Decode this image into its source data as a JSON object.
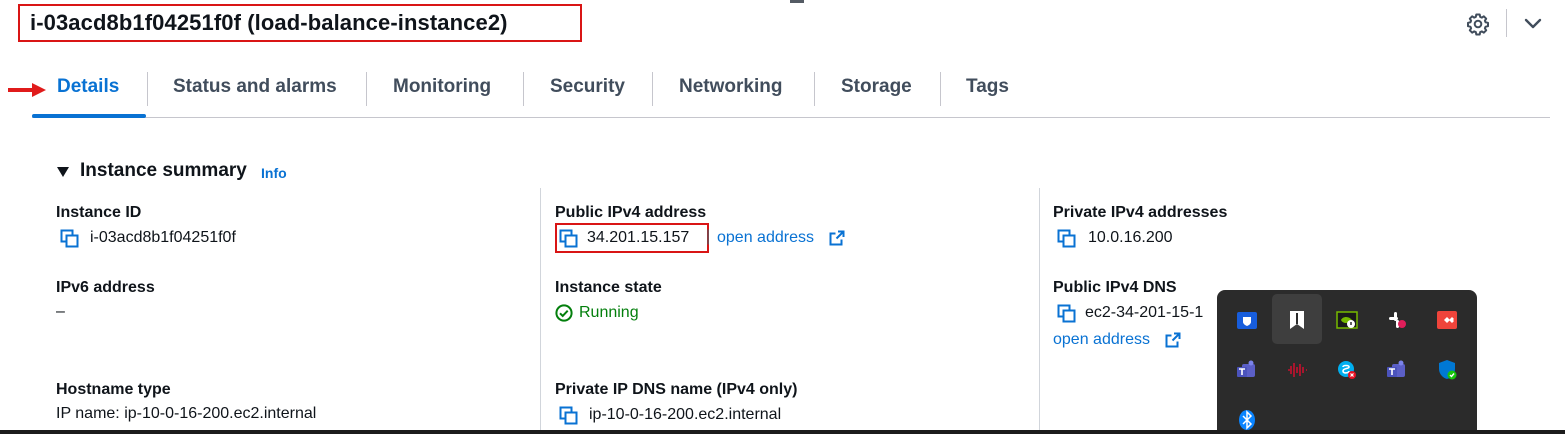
{
  "header": {
    "title": "i-03acd8b1f04251f0f (load-balance-instance2)"
  },
  "tabs": [
    {
      "label": "Details",
      "active": true
    },
    {
      "label": "Status and alarms"
    },
    {
      "label": "Monitoring"
    },
    {
      "label": "Security"
    },
    {
      "label": "Networking"
    },
    {
      "label": "Storage"
    },
    {
      "label": "Tags"
    }
  ],
  "summary": {
    "title": "Instance summary",
    "info_link": "Info"
  },
  "fields": {
    "instance_id": {
      "label": "Instance ID",
      "value": "i-03acd8b1f04251f0f"
    },
    "public_ipv4": {
      "label": "Public IPv4 address",
      "value": "34.201.15.157",
      "link": "open address"
    },
    "private_ipv4": {
      "label": "Private IPv4 addresses",
      "value": "10.0.16.200"
    },
    "ipv6": {
      "label": "IPv6 address",
      "value": "–"
    },
    "instance_state": {
      "label": "Instance state",
      "value": "Running"
    },
    "public_dns": {
      "label": "Public IPv4 DNS",
      "value": "ec2-34-201-15-1",
      "link": "open address"
    },
    "hostname_type": {
      "label": "Hostname type",
      "value": "IP name: ip-10-0-16-200.ec2.internal"
    },
    "private_dns": {
      "label": "Private IP DNS name (IPv4 only)",
      "value": "ip-10-0-16-200.ec2.internal"
    }
  },
  "tray_icons": [
    "bitwarden-icon",
    "bookmark-app-icon",
    "nvidia-icon",
    "slack-icon",
    "anydesk-icon",
    "teams-icon",
    "audio-wave-icon",
    "skype-icon",
    "teams-icon-2",
    "windows-security-icon",
    "bluetooth-icon"
  ],
  "colors": {
    "link": "#0972d3",
    "success": "#037f0c",
    "highlight_box": "#d91515",
    "text": "#0f141a"
  }
}
